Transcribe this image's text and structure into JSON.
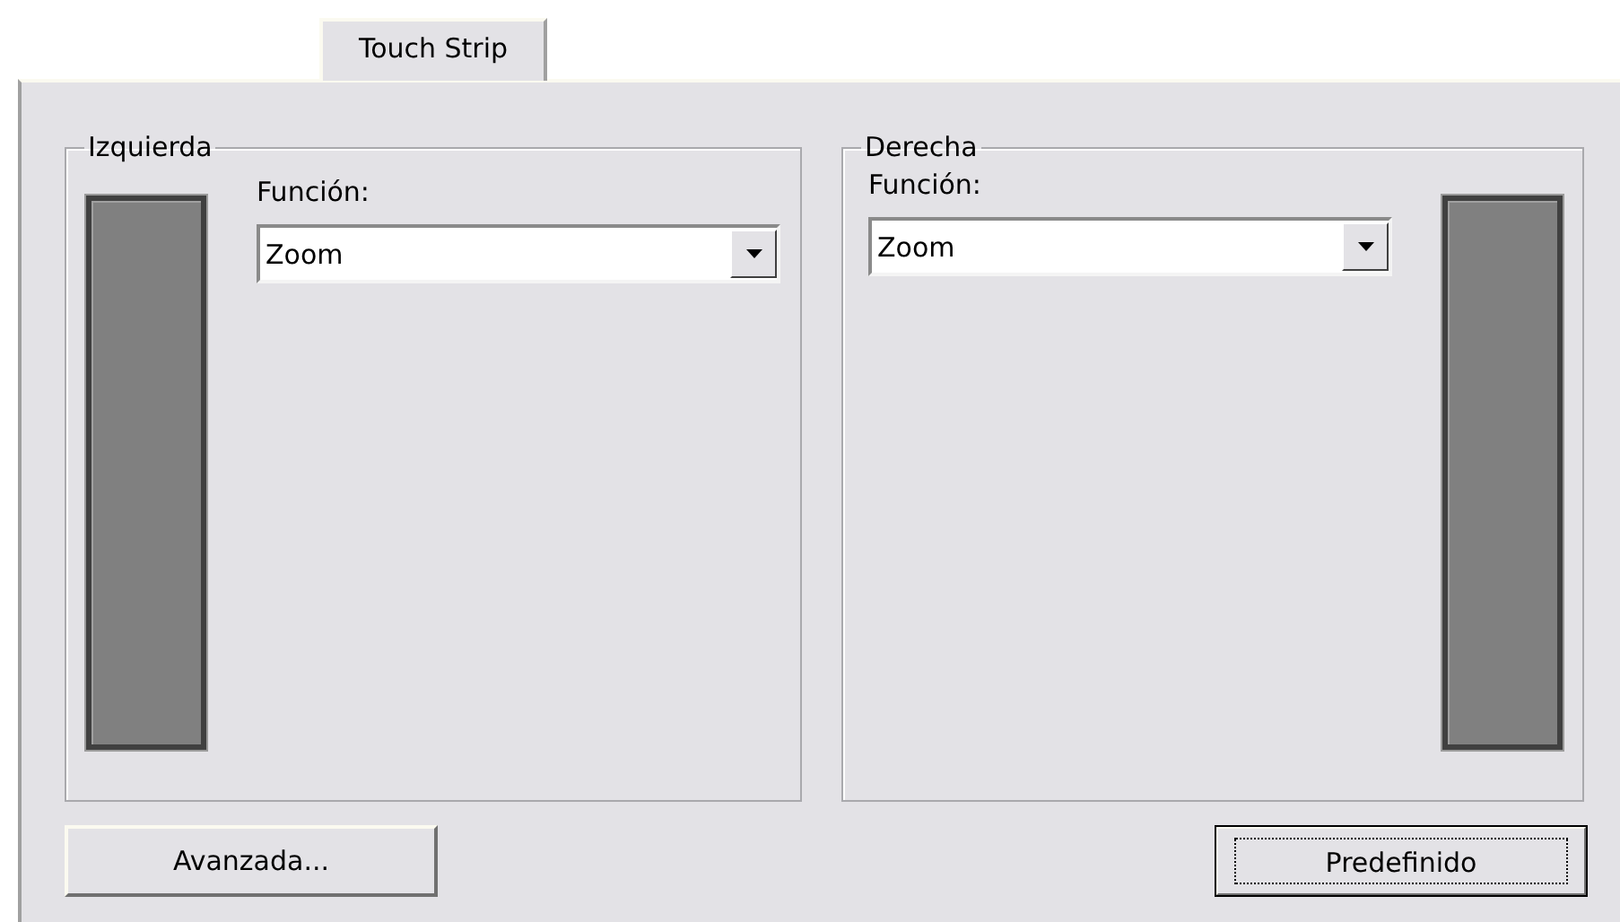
{
  "tabs": [
    {
      "label": "Touch Strip",
      "selected": true
    }
  ],
  "groups": [
    {
      "title": "Izquierda",
      "kind": "strip-left",
      "function_label": "Función:",
      "function_value": "Zoom"
    },
    {
      "title": "Derecha",
      "kind": "strip-right",
      "function_label": "Función:",
      "function_value": "Zoom"
    }
  ],
  "buttons": [
    {
      "label": "Avanzada...",
      "focused": false
    },
    {
      "label": "Predefinido",
      "focused": true
    }
  ]
}
